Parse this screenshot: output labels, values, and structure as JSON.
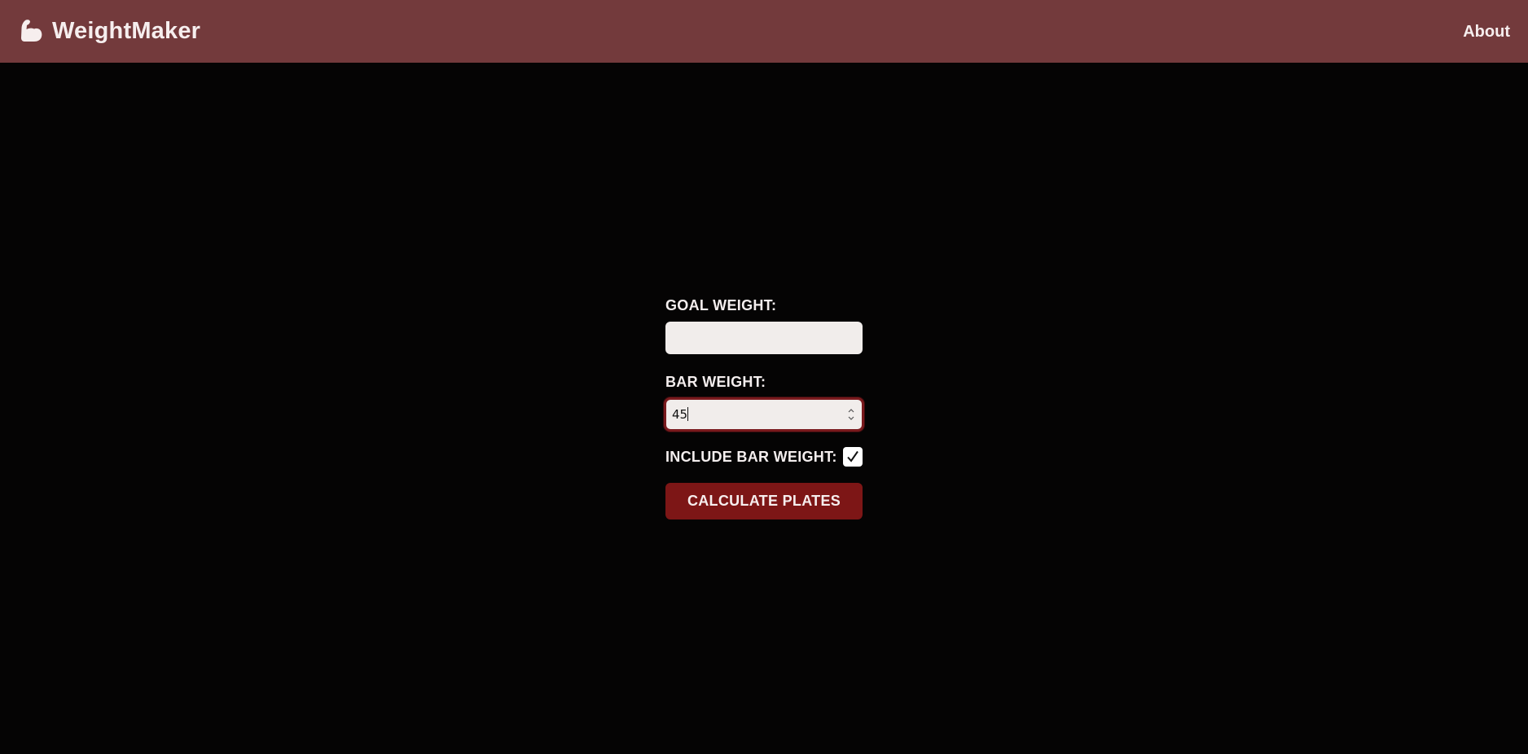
{
  "navbar": {
    "brand_name": "WeightMaker",
    "brand_icon": "flexed-bicep-icon",
    "about_label": "About"
  },
  "form": {
    "goal_weight_label": "GOAL WEIGHT:",
    "goal_weight_value": "",
    "bar_weight_label": "BAR WEIGHT:",
    "bar_weight_value": "45",
    "include_bar_label": "INCLUDE BAR WEIGHT:",
    "include_bar_checked": true,
    "calculate_label": "CALCULATE PLATES"
  },
  "colors": {
    "navbar_bg": "#733a3c",
    "page_bg": "#050404",
    "button_bg": "#7d1616",
    "focus_ring": "#7a1a1d",
    "input_bg": "#f1edeb"
  }
}
